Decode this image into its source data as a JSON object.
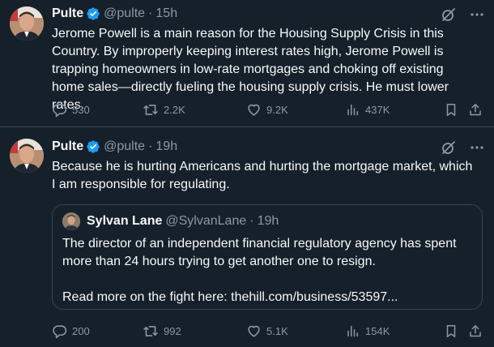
{
  "tweets": [
    {
      "name": "Pulte",
      "handle": "@pulte",
      "time": "15h",
      "text": "Jerome Powell is a main reason for the Housing Supply Crisis in this Country. By improperly keeping interest rates high, Jerome Powell is trapping homeowners in low-rate mortgages and choking off existing home sales—directly fueling the housing supply crisis. He must lower rates.",
      "replies": "530",
      "retweets": "2.2K",
      "likes": "9.2K",
      "views": "437K"
    },
    {
      "name": "Pulte",
      "handle": "@pulte",
      "time": "19h",
      "text": "Because he is hurting Americans and hurting the mortgage market, which I am responsible for regulating.",
      "replies": "200",
      "retweets": "992",
      "likes": "5.1K",
      "views": "154K",
      "quote": {
        "name": "Sylvan Lane",
        "handle": "@SylvanLane",
        "time": "19h",
        "text": "The director of an independent financial regulatory agency has spent more than 24 hours trying to get another one to resign.\n\nRead more on the fight here: thehill.com/business/53597..."
      }
    }
  ],
  "separator": "·",
  "icons": [
    "verified-badge-icon",
    "grok-icon",
    "more-icon",
    "reply-icon",
    "retweet-icon",
    "like-icon",
    "views-icon",
    "bookmark-icon",
    "share-icon"
  ],
  "colors": {
    "background": "#15202b",
    "text": "#f7f9f9",
    "muted": "#8b98a5",
    "verified": "#1d9bf0",
    "border": "#38444d"
  }
}
